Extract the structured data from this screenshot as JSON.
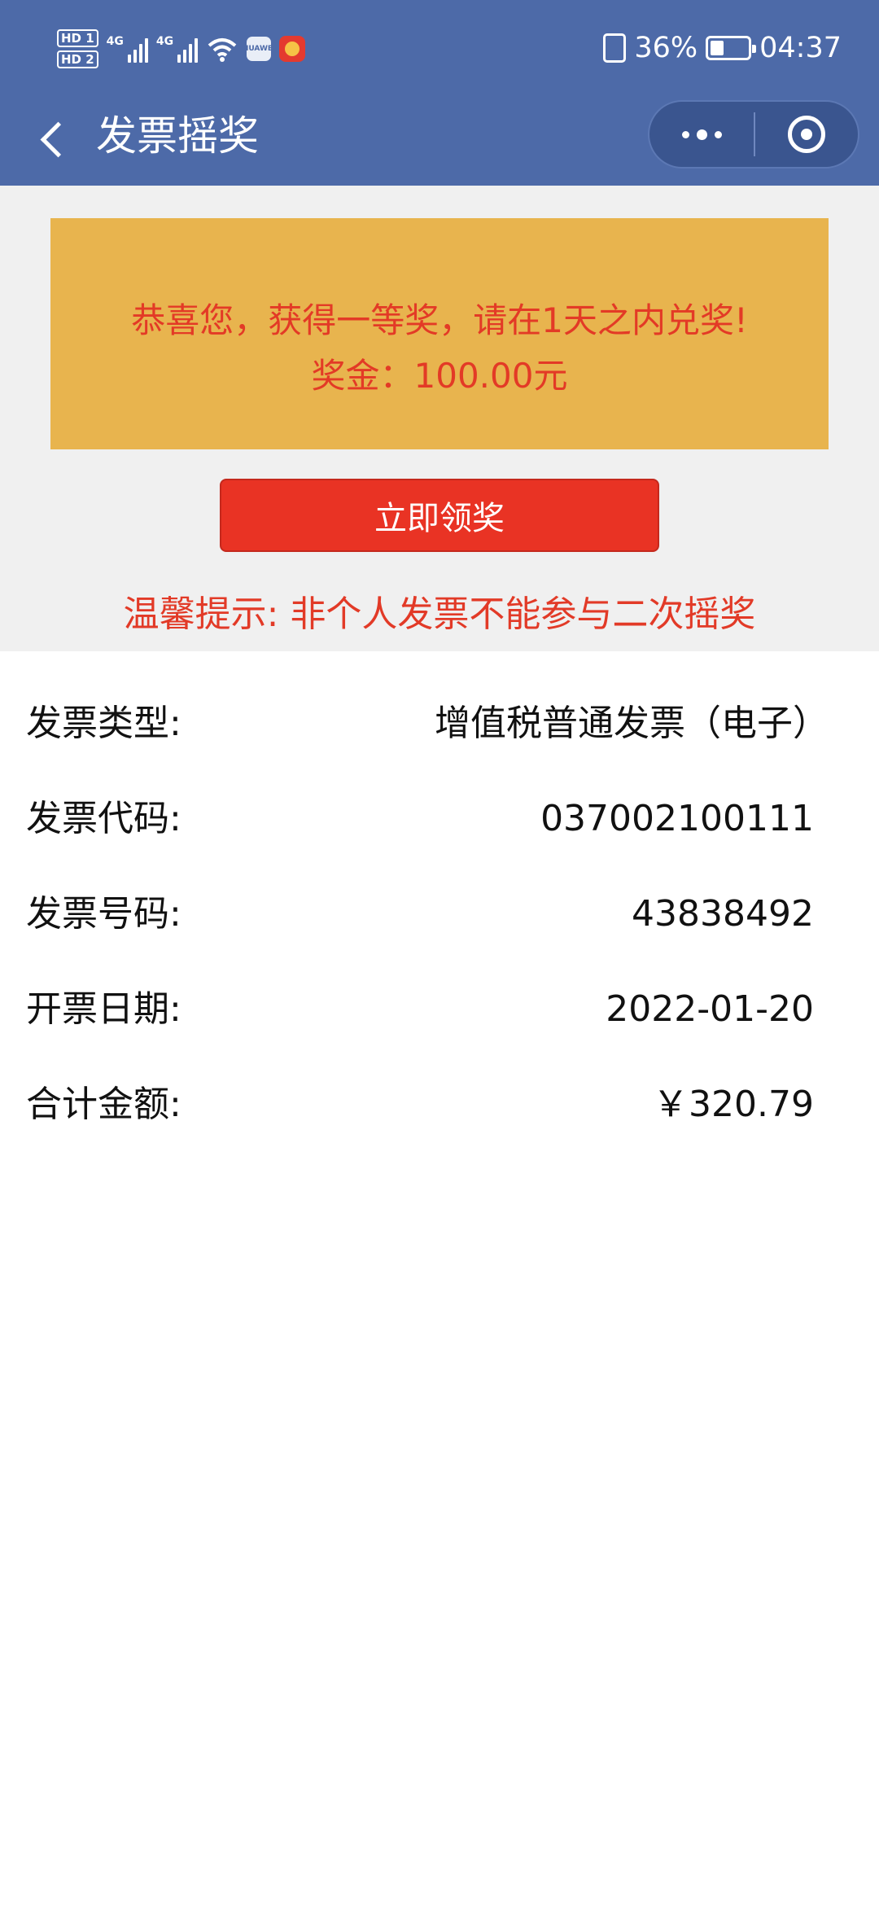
{
  "status_bar": {
    "hd1": "HD 1",
    "hd2": "HD 2",
    "sig1_label": "4G",
    "sig2_label": "4G",
    "app_badge_text": "HUAWEI",
    "battery_percent": "36%",
    "battery_level": 0.36,
    "time": "04:37"
  },
  "nav": {
    "title": "发票摇奖",
    "back_icon": "chevron-left-icon",
    "more_icon": "more-dots-icon",
    "close_icon": "target-ring-icon"
  },
  "prize": {
    "message": "恭喜您，获得一等奖，请在1天之内兑奖!",
    "amount": "奖金：100.00元",
    "button_label": "立即领奖",
    "tip": "温馨提示: 非个人发票不能参与二次摇奖"
  },
  "details": [
    {
      "label": "发票类型:",
      "value": "增值税普通发票（电子）"
    },
    {
      "label": "发票代码:",
      "value": "037002100111"
    },
    {
      "label": "发票号码:",
      "value": "43838492"
    },
    {
      "label": "开票日期:",
      "value": "2022-01-20"
    },
    {
      "label": "合计金额:",
      "value": "￥320.79"
    }
  ],
  "colors": {
    "header": "#4d6aa8",
    "ticket": "#e8b44e",
    "accent_red": "#e93324"
  }
}
